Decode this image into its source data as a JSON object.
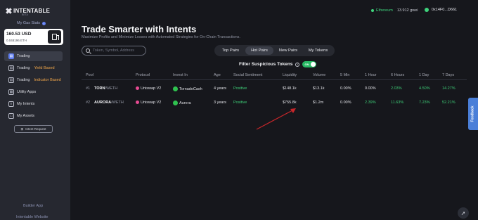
{
  "brand": {
    "name": "INTENTABLE",
    "badge": "BETA"
  },
  "sidebar": {
    "gas_stats_label": "My Gas Stats",
    "balance_usd": "160.53 USD",
    "balance_eth": "0.048196 ETH",
    "items": [
      {
        "label": "Trading",
        "sub": ""
      },
      {
        "label": "Trading",
        "sub": "Yield Based"
      },
      {
        "label": "Trading",
        "sub": "Indicator Based"
      },
      {
        "label": "Utility Apps",
        "sub": ""
      },
      {
        "label": "My Intents",
        "sub": ""
      },
      {
        "label": "My Assets",
        "sub": ""
      }
    ],
    "intent_request_label": "Intent Request",
    "builder_app_label": "Builder App",
    "website_label": "Intentable Website"
  },
  "topbar": {
    "network": "Ethereum",
    "gas": "13.912 gwei",
    "wallet": "0x14F0...D661"
  },
  "main": {
    "title": "Trade Smarter with Intents",
    "subtitle": "Maximize Profits and Minimize Losses with Automated Strategies for On-Chain Transactions.",
    "search_placeholder": "Token, Symbol, Address",
    "tabs": [
      "Top Pairs",
      "Hot Pairs",
      "New Pairs",
      "My Tokens"
    ],
    "active_tab": "Hot Pairs",
    "filter_label": "Filter Suspicious Tokens",
    "filter_toggle": "ON"
  },
  "table": {
    "columns": [
      "Pool",
      "Protocol",
      "Invest In",
      "Age",
      "Social Sentiment",
      "Liquidity",
      "Volume",
      "5 Min",
      "1 Hour",
      "6 Hours",
      "1 Day",
      "7 Days"
    ],
    "rows": [
      {
        "rank": "#1",
        "base": "TORN",
        "quote": "/WETH",
        "protocol": "Uniswap V2",
        "invest_in": "TornadoCash",
        "age": "4 years",
        "sentiment": "Positive",
        "liquidity": "$148.1k",
        "volume": "$13.1k",
        "m5": "0.00%",
        "h1": "0.00%",
        "h6": "2.03%",
        "d1": "4.50%",
        "d7": "14.27%"
      },
      {
        "rank": "#2",
        "base": "AURORA",
        "quote": "/WETH",
        "protocol": "Uniswap V2",
        "invest_in": "Aurora",
        "age": "3 years",
        "sentiment": "Positive",
        "liquidity": "$755.8k",
        "volume": "$1.2m",
        "m5": "0.00%",
        "h1": "2.39%",
        "h6": "11.63%",
        "d1": "7.23%",
        "d7": "52.21%"
      }
    ]
  },
  "feedback_label": "Feedback",
  "colors": {
    "positive": "#3ecf78",
    "accent": "#5f7df0",
    "toggle_on": "#27b763",
    "arrow": "#c8262a"
  }
}
